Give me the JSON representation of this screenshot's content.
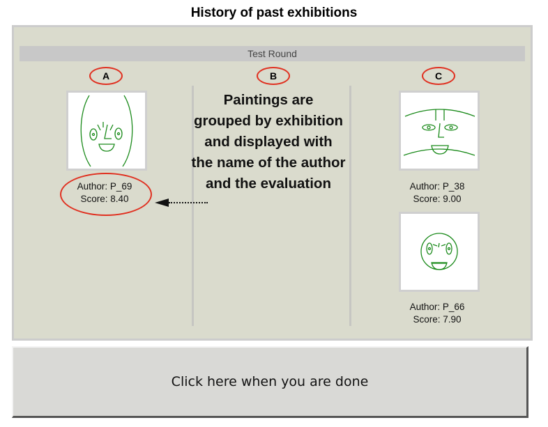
{
  "page_title": "History of past exhibitions",
  "round_label": "Test Round",
  "columns": [
    {
      "label": "A",
      "paintings": [
        {
          "author": "Author: P_69",
          "score": "Score: 8.40"
        }
      ]
    },
    {
      "label": "B",
      "paintings": []
    },
    {
      "label": "C",
      "paintings": [
        {
          "author": "Author: P_38",
          "score": "Score: 9.00"
        },
        {
          "author": "Author: P_66",
          "score": "Score: 7.90"
        }
      ]
    }
  ],
  "annotation": {
    "lines": [
      "Paintings are",
      "grouped by exhibition",
      "and displayed with",
      "the name of the author",
      "and the evaluation"
    ]
  },
  "done_button_label": "Click here when you are done",
  "colors": {
    "panel_bg": "#dadbcd",
    "highlight_red": "#e03020",
    "drawing_green": "#1a8a1a"
  }
}
